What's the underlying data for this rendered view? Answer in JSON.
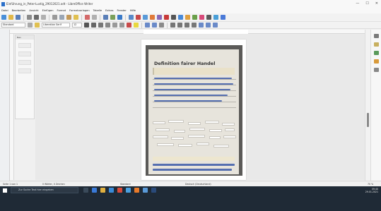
{
  "window": {
    "title": "Einführung_in_Peter-Lustig_29012021.odt - LibreOffice Writer",
    "controls": [
      "—",
      "☐",
      "✕"
    ]
  },
  "menu": [
    "Datei",
    "Bearbeiten",
    "Ansicht",
    "Einfügen",
    "Format",
    "Formatvorlagen",
    "Tabelle",
    "Extras",
    "Fenster",
    "Hilfe"
  ],
  "toolbar2": {
    "paragraph_style": "Standard",
    "font_name": "Liberation Serif",
    "font_size": "12"
  },
  "navigator": {
    "title": "Nav"
  },
  "document": {
    "worksheet_title": "Definition fairer Handel",
    "handwriting": "Wenn der Produzent einen fairen Preis bekommt"
  },
  "statusbar": {
    "page": "Seite 1 von 1",
    "words": "0 Wörter, 0 Zeichen",
    "style": "Standard",
    "language": "Deutsch (Deutschland)",
    "zoom": "70 %"
  },
  "taskbar": {
    "search_placeholder": "Zur Suche Text hier eingeben",
    "time": "09:40",
    "date": "29.01.2021"
  }
}
